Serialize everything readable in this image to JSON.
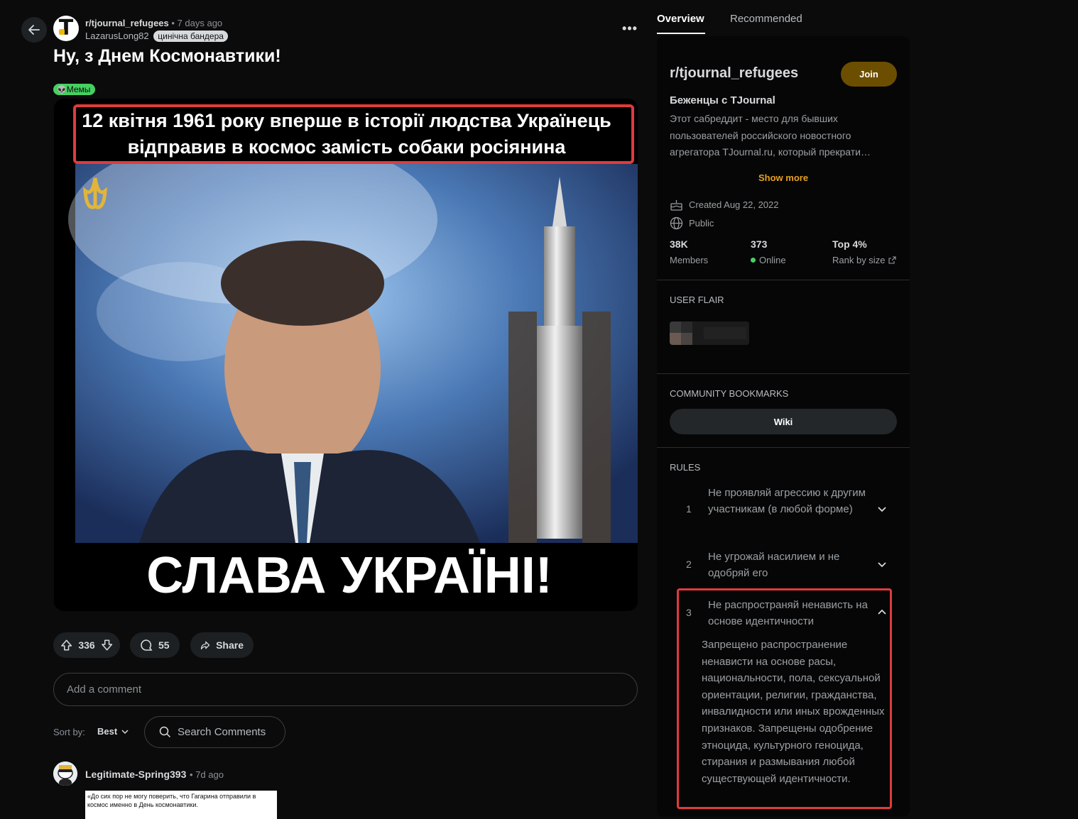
{
  "post": {
    "subreddit": "r/tjournal_refugees",
    "time": "• 7 days ago",
    "author": "LazarusLong82",
    "author_flair": "цинічна бандера",
    "title": "Ну, з Днем Космонавтики!",
    "flair": "Мемы",
    "image": {
      "top_caption_line1": "12 квітня 1961 року вперше в історії людства Українець",
      "top_caption_line2": "відправив в космос замість собаки росіянина",
      "bottom_caption": "СЛАВА УКРАЇНІ!"
    },
    "votes": "336",
    "comments": "55",
    "share_label": "Share"
  },
  "comment_input": {
    "placeholder": "Add a comment"
  },
  "sort": {
    "label": "Sort by:",
    "value": "Best"
  },
  "search_comments": {
    "placeholder": "Search Comments"
  },
  "comment": {
    "author": "Legitimate-Spring393",
    "time": "• 7d ago",
    "quote": "«До сих пор не могу поверить, что Гагарина отправили в космос именно в День космонавтики."
  },
  "tabs": {
    "overview": "Overview",
    "recommended": "Recommended"
  },
  "sidebar": {
    "subreddit": "r/tjournal_refugees",
    "join": "Join",
    "headline": "Беженцы с TJournal",
    "description": "Этот сабреддит - место для бывших пользователей российского новостного агрегатора TJournal.ru, который прекрати…",
    "show_more": "Show more",
    "created": "Created Aug 22, 2022",
    "visibility": "Public",
    "stats": {
      "members_value": "38K",
      "members_label": "Members",
      "online_value": "373",
      "online_label": "Online",
      "rank_value": "Top 4%",
      "rank_label": "Rank by size"
    },
    "user_flair_heading": "USER FLAIR",
    "bookmarks_heading": "COMMUNITY BOOKMARKS",
    "wiki": "Wiki",
    "rules_heading": "RULES",
    "rules": [
      {
        "num": "1",
        "text": "Не проявляй агрессию к другим участникам (в любой форме)"
      },
      {
        "num": "2",
        "text": "Не угрожай насилием и не одобряй его"
      },
      {
        "num": "3",
        "text": "Не распространяй ненависть на основе идентичности",
        "detail": "Запрещено распространение ненависти на основе расы, национальности, пола, сексуальной ориентации, религии, гражданства, инвалидности или иных врожденных признаков. Запрещены одобрение этноцида, культурного геноцида, стирания и размывания любой существующей идентичности."
      }
    ]
  },
  "colors": {
    "accent": "#e6a120",
    "join_bg": "#6c4e00",
    "highlight": "#e03b3b",
    "flair_green": "#46d160"
  }
}
